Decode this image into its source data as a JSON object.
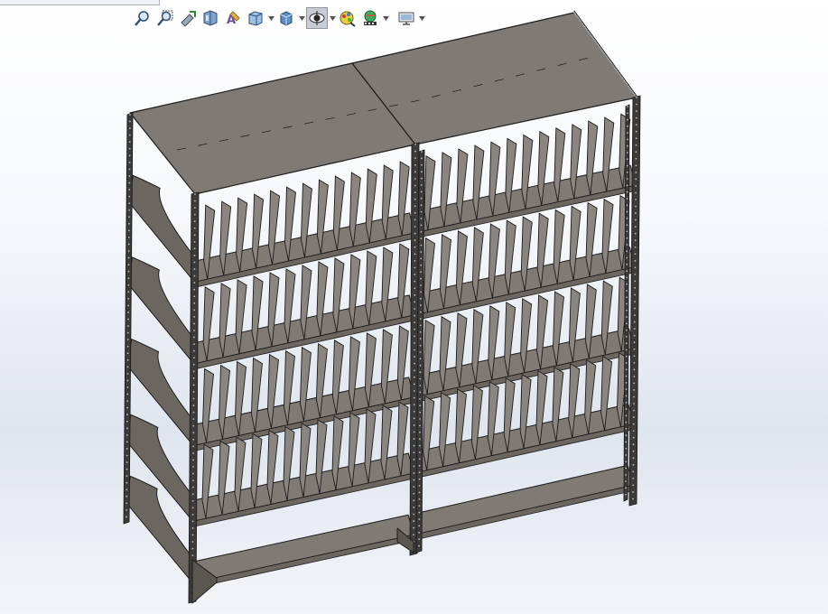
{
  "toolbar": {
    "buttons": [
      {
        "icon": "zoom-to-fit-icon",
        "dropdown": false
      },
      {
        "icon": "zoom-to-area-icon",
        "dropdown": false
      },
      {
        "icon": "previous-view-icon",
        "dropdown": false
      },
      {
        "icon": "section-view-icon",
        "dropdown": false
      },
      {
        "icon": "dynamic-annotation-icon",
        "dropdown": false
      },
      {
        "icon": "view-orientation-icon",
        "dropdown": true
      },
      {
        "icon": "display-style-icon",
        "dropdown": true
      },
      {
        "icon": "hide-show-items-icon",
        "dropdown": true,
        "active": true
      },
      {
        "icon": "edit-appearance-icon",
        "dropdown": false
      },
      {
        "icon": "apply-scene-icon",
        "dropdown": true
      },
      {
        "icon": "view-settings-icon",
        "dropdown": true
      }
    ]
  },
  "model": {
    "name": "shelving-unit-3d-model",
    "colors": {
      "shelf_top": "#7f7a73",
      "shelf_side": "#6b665f",
      "divider": "#8a857e",
      "frame": "#3d3b39",
      "edge": "#1c1c1c",
      "shadow": "#5a5650"
    }
  }
}
